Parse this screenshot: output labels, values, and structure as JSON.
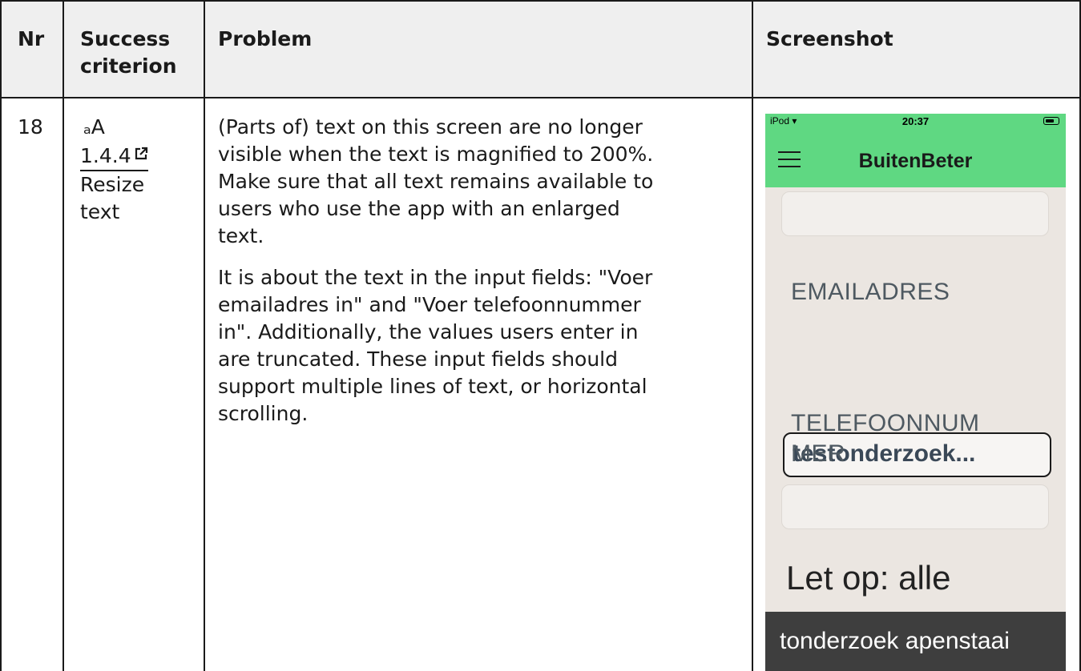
{
  "table": {
    "headers": {
      "nr": "Nr",
      "criterion_line1": "Success",
      "criterion_line2": "criterion",
      "problem": "Problem",
      "screenshot": "Screenshot"
    },
    "row": {
      "nr": "18",
      "criterion_glyph": "ₐA",
      "criterion_code": "1.4.4",
      "criterion_name_line1": "Resize",
      "criterion_name_line2": "text",
      "problem_p1_lines": [
        "(Parts of) text on this screen are no longer",
        "visible when the text is magnified to 200%.",
        "Make sure that all text remains available to",
        "users who use the app with an enlarged",
        "text."
      ],
      "problem_p2_lines": [
        "It is about the text in the input fields: \"Voer",
        "emailadres in\" and \"Voer telefoonnummer",
        "in\". Additionally, the values users enter in",
        "are truncated. These input fields should",
        "support multiple lines of text, or horizontal",
        "scrolling."
      ]
    }
  },
  "phone": {
    "status": {
      "device": "iPod",
      "time": "20:37"
    },
    "app_title": "BuitenBeter",
    "email_label": "EMAILADRES",
    "email_value": "testonderzoek...",
    "phone_label_line1": "TELEFOONNUM",
    "phone_label_line2": "MER",
    "notice": "Let op: alle",
    "bottom_text": "tonderzoek apenstaai",
    "colors": {
      "nav": "#5fd882",
      "background": "#ebe6e1",
      "bottom_bar": "#3e3e3e"
    }
  }
}
